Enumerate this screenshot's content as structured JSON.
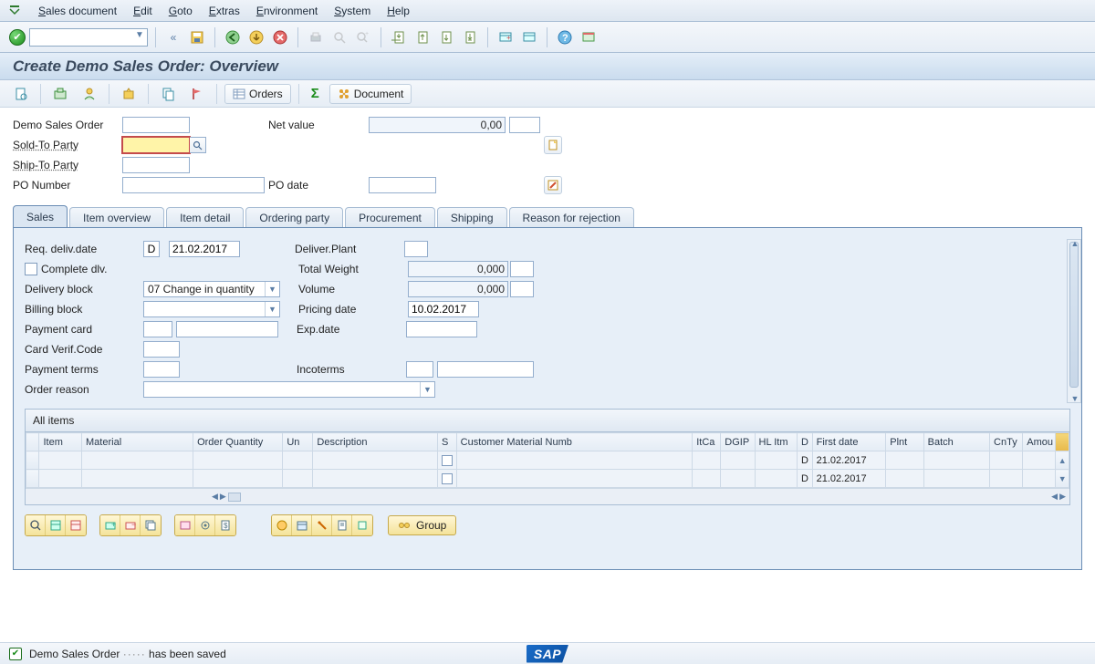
{
  "menu": [
    "Sales document",
    "Edit",
    "Goto",
    "Extras",
    "Environment",
    "System",
    "Help"
  ],
  "title": "Create Demo Sales Order: Overview",
  "app_tb": {
    "orders_label": "Orders",
    "document_label": "Document"
  },
  "header": {
    "demo_label": "Demo Sales Order",
    "demo_value": "",
    "netvalue_label": "Net value",
    "netvalue": "0,00",
    "currency": "",
    "soldto_label": "Sold-To Party",
    "soldto": "",
    "shipto_label": "Ship-To Party",
    "shipto": "",
    "ponum_label": "PO Number",
    "ponum": "",
    "podate_label": "PO date",
    "podate": ""
  },
  "tabs": [
    "Sales",
    "Item overview",
    "Item detail",
    "Ordering party",
    "Procurement",
    "Shipping",
    "Reason for rejection"
  ],
  "sales": {
    "reqdate_label": "Req. deliv.date",
    "reqdate_type": "D",
    "reqdate": "21.02.2017",
    "delplant_label": "Deliver.Plant",
    "delplant": "",
    "complete_label": "Complete dlv.",
    "totweight_label": "Total Weight",
    "totweight": "0,000",
    "totweight_unit": "",
    "delblock_label": "Delivery block",
    "delblock": "07 Change in quantity",
    "volume_label": "Volume",
    "volume": "0,000",
    "volume_unit": "",
    "billblock_label": "Billing block",
    "billblock": "",
    "pricedate_label": "Pricing date",
    "pricedate": "10.02.2017",
    "paycard_label": "Payment card",
    "paycard_type": "",
    "paycard": "",
    "expdate_label": "Exp.date",
    "expdate": "",
    "cvc_label": "Card Verif.Code",
    "cvc": "",
    "payterms_label": "Payment terms",
    "payterms": "",
    "inco_label": "Incoterms",
    "inco1": "",
    "inco2": "",
    "reason_label": "Order reason",
    "reason": ""
  },
  "items": {
    "title": "All items",
    "cols": [
      "Item",
      "Material",
      "Order Quantity",
      "Un",
      "Description",
      "S",
      "Customer Material Numb",
      "ItCa",
      "DGIP",
      "HL Itm",
      "D",
      "First date",
      "Plnt",
      "Batch",
      "CnTy",
      "Amou"
    ],
    "rows": [
      {
        "d": "D",
        "first_date": "21.02.2017"
      },
      {
        "d": "D",
        "first_date": "21.02.2017"
      }
    ]
  },
  "group_label": "Group",
  "status": {
    "msg_prefix": "Demo Sales Order ",
    "msg_id": "·····",
    "msg_suffix": "  has been saved"
  }
}
